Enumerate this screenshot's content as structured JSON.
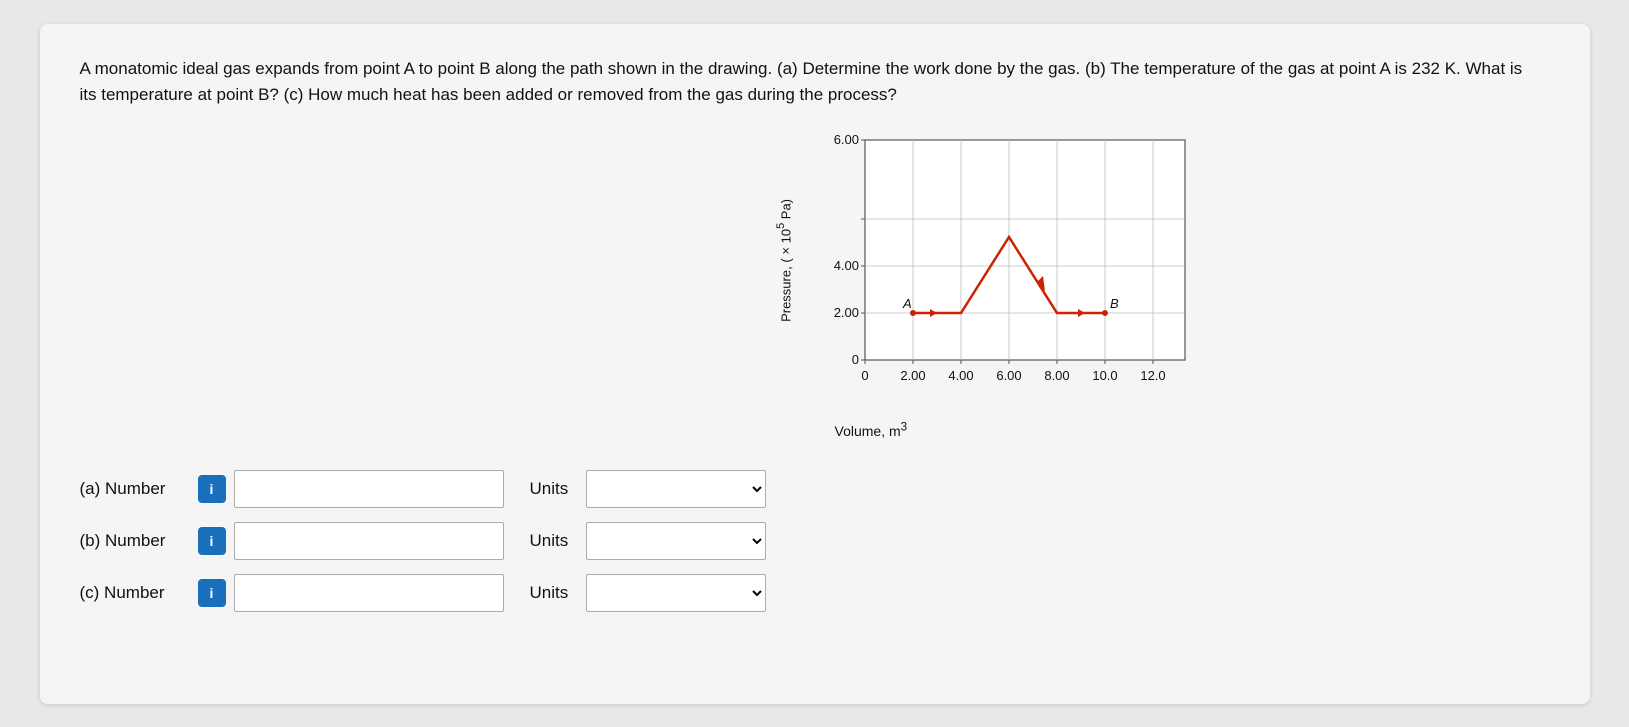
{
  "problem": {
    "text": "A monatomic ideal gas expands from point A to point B along the path shown in the drawing. (a) Determine the work done by the gas. (b) The temperature of the gas at point A is 232 K. What is its temperature at point B? (c) How much heat has been added or removed from the gas during the process?"
  },
  "chart": {
    "y_axis_label": "Pressure, (×10⁵ Pa)",
    "x_axis_label": "Volume, m³",
    "y_ticks": [
      "6.00",
      "4.00",
      "2.00",
      "0"
    ],
    "x_ticks": [
      "0",
      "2.00",
      "4.00",
      "6.00",
      "8.00",
      "10.0",
      "12.0"
    ],
    "point_a_label": "A",
    "point_b_label": "B"
  },
  "answers": [
    {
      "id": "a",
      "label": "(a) Number",
      "info_label": "i",
      "units_label": "Units",
      "input_value": "",
      "input_placeholder": "",
      "units_placeholder": ""
    },
    {
      "id": "b",
      "label": "(b) Number",
      "info_label": "i",
      "units_label": "Units",
      "input_value": "",
      "input_placeholder": "",
      "units_placeholder": ""
    },
    {
      "id": "c",
      "label": "(c) Number",
      "info_label": "i",
      "units_label": "Units",
      "input_value": "",
      "input_placeholder": "",
      "units_placeholder": ""
    }
  ]
}
